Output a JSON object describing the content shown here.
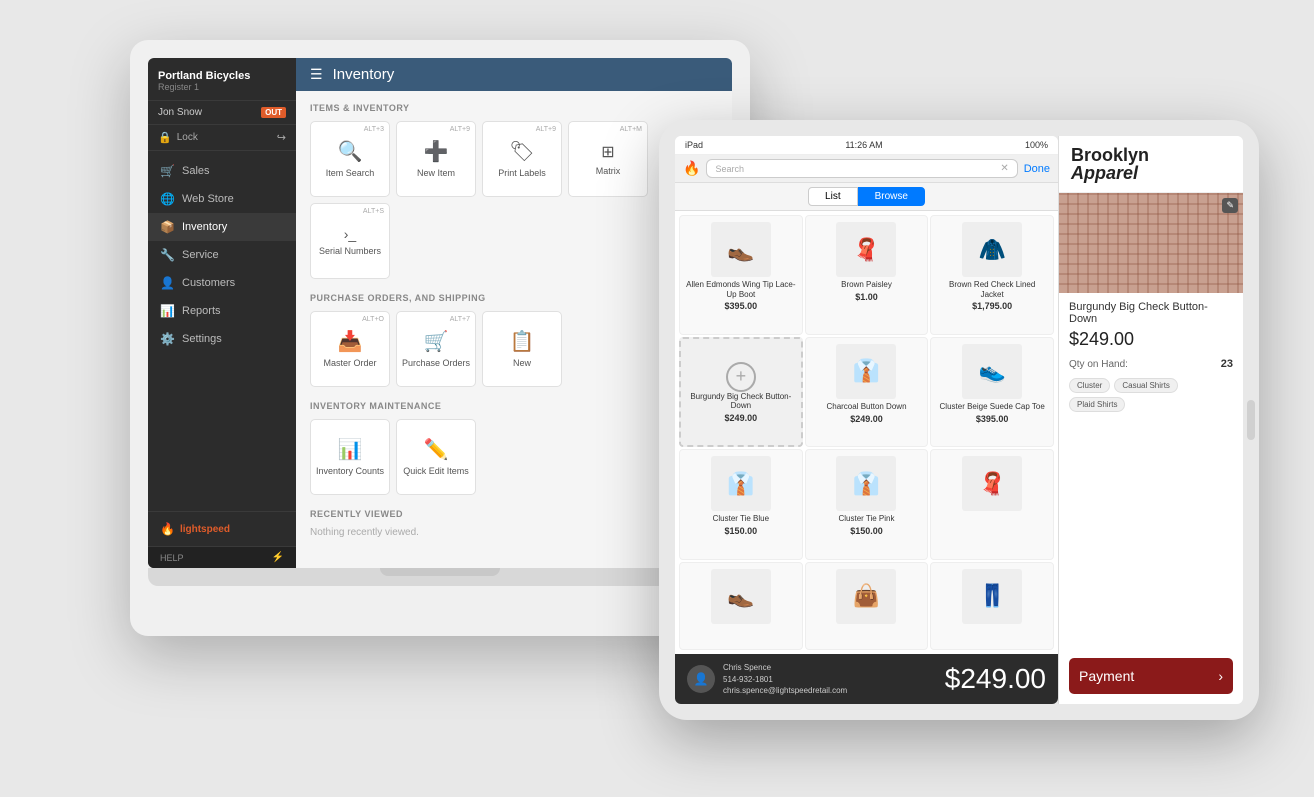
{
  "laptop": {
    "store_name": "Portland Bicycles",
    "register": "Register 1",
    "user": "Jon Snow",
    "out_badge": "OUT",
    "lock_label": "Lock",
    "nav_items": [
      {
        "id": "sales",
        "label": "Sales",
        "icon": "🛒"
      },
      {
        "id": "webstore",
        "label": "Web Store",
        "icon": "🌐"
      },
      {
        "id": "inventory",
        "label": "Inventory",
        "icon": "📦"
      },
      {
        "id": "service",
        "label": "Service",
        "icon": "🔧"
      },
      {
        "id": "customers",
        "label": "Customers",
        "icon": "👤"
      },
      {
        "id": "reports",
        "label": "Reports",
        "icon": "📊"
      },
      {
        "id": "settings",
        "label": "Settings",
        "icon": "⚙️"
      }
    ],
    "logo": "lightspeed",
    "help_label": "HELP",
    "main_title": "Inventory",
    "section1_label": "ITEMS & INVENTORY",
    "items_inventory": [
      {
        "label": "Item Search",
        "shortcut": "ALT+3",
        "icon": "🔍"
      },
      {
        "label": "New Item",
        "shortcut": "ALT+9",
        "icon": "➕"
      },
      {
        "label": "Print Labels",
        "shortcut": "ALT+9",
        "icon": "🏷"
      },
      {
        "label": "Matrix",
        "shortcut": "ALT+M",
        "icon": "⊞"
      },
      {
        "label": "Serial Numbers",
        "shortcut": "ALT+S",
        "icon": ">_"
      }
    ],
    "section2_label": "PURCHASE ORDERS, AND SHIPPING",
    "purchase_orders": [
      {
        "label": "Master Order",
        "shortcut": "ALT+O",
        "icon": "📥"
      },
      {
        "label": "Purchase Orders",
        "shortcut": "ALT+7",
        "icon": "🛒"
      },
      {
        "label": "New",
        "shortcut": "",
        "icon": "📋"
      }
    ],
    "section3_label": "INVENTORY MAINTENANCE",
    "maintenance": [
      {
        "label": "Inventory Counts",
        "shortcut": "",
        "icon": "📊"
      },
      {
        "label": "Quick Edit Items",
        "shortcut": "",
        "icon": "✏️"
      }
    ],
    "recently_viewed_label": "RECENTLY VIEWED",
    "nothing_text": "Nothing recently viewed."
  },
  "ipad": {
    "time": "11:26 AM",
    "battery": "100%",
    "done_label": "Done",
    "list_tab": "List",
    "browse_tab": "Browse",
    "search_placeholder": "Search",
    "products": [
      {
        "name": "Allen Edmonds Wing Tip Lace-Up Boot",
        "price": "$395.00",
        "emoji": "👞"
      },
      {
        "name": "Brown Paisley",
        "price": "$1.00",
        "emoji": "🧣"
      },
      {
        "name": "Brown Red Check Lined Jacket",
        "price": "$1,795.00",
        "emoji": "🧥"
      },
      {
        "name": "Burgundy Big Check Button-Down",
        "price": "$249.00",
        "emoji": "+",
        "is_add": true
      },
      {
        "name": "Charcoal Button Down",
        "price": "$249.00",
        "emoji": "👔"
      },
      {
        "name": "Cluster Beige Suede Cap Toe",
        "price": "$395.00",
        "emoji": "👟"
      },
      {
        "name": "Cluster Tie Blue",
        "price": "$150.00",
        "emoji": "👔"
      },
      {
        "name": "Cluster Tie Pink",
        "price": "$150.00",
        "emoji": "👔"
      },
      {
        "name": "",
        "price": "",
        "emoji": "🧣"
      },
      {
        "name": "",
        "price": "",
        "emoji": "👞"
      },
      {
        "name": "",
        "price": "",
        "emoji": "👜"
      },
      {
        "name": "",
        "price": "",
        "emoji": "👖"
      }
    ],
    "customer_name": "Chris Spence",
    "customer_phone": "514-932-1801",
    "customer_email": "chris.spence@lightspeedretail.com",
    "total": "$249.00",
    "detail": {
      "brand": "Brooklyn",
      "brand_sub": "Apparel",
      "product_name": "Burgundy Big Check Button-Down",
      "price": "$249.00",
      "qty_label": "Qty on Hand:",
      "qty_value": "23",
      "tags": [
        "Cluster",
        "Casual Shirts",
        "Plaid Shirts"
      ],
      "payment_label": "Payment"
    }
  }
}
